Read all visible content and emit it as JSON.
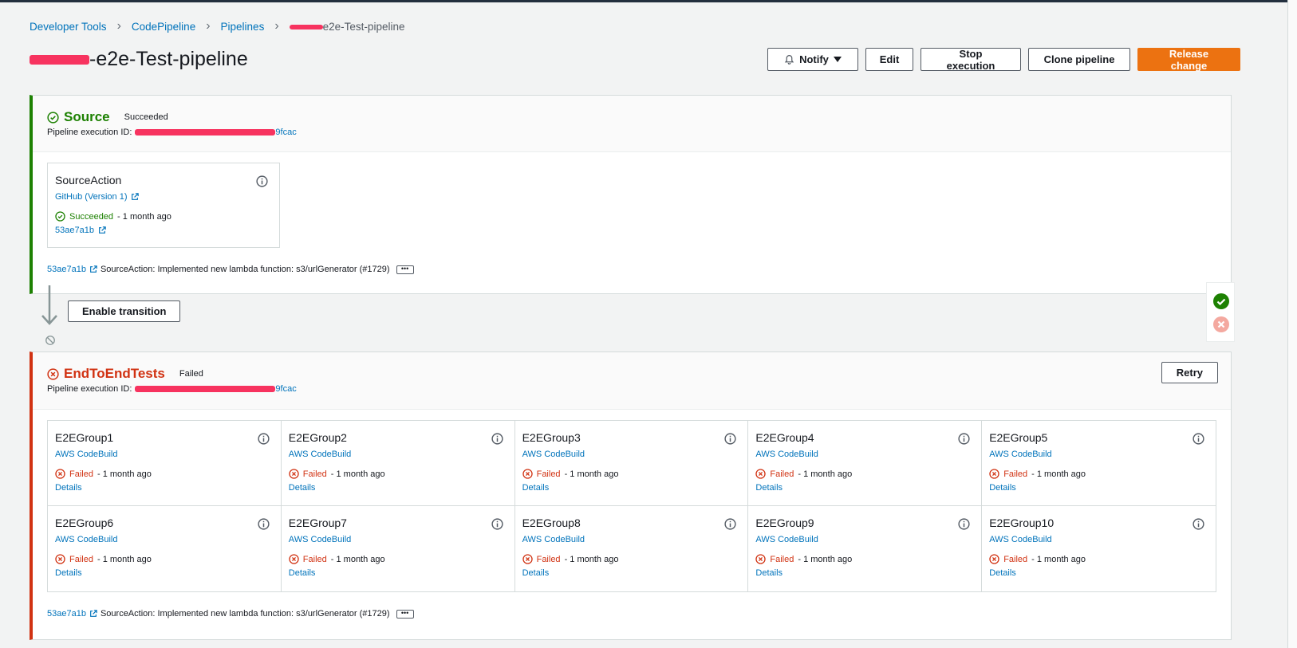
{
  "breadcrumb": {
    "items": [
      "Developer Tools",
      "CodePipeline",
      "Pipelines"
    ],
    "current": "e2e-Test-pipeline"
  },
  "page": {
    "title": "-e2e-Test-pipeline"
  },
  "header_buttons": {
    "notify": "Notify",
    "edit": "Edit",
    "stop": "Stop execution",
    "clone": "Clone pipeline",
    "release": "Release change"
  },
  "source_stage": {
    "name": "Source",
    "status": "Succeeded",
    "exec_label": "Pipeline execution ID:",
    "exec_id_suffix": "9fcac",
    "action": {
      "name": "SourceAction",
      "provider": "GitHub (Version 1)",
      "status": "Succeeded",
      "time": "- 1 month ago",
      "commit": "53ae7a1b"
    },
    "commit_line": {
      "commit": "53ae7a1b",
      "message": "SourceAction: Implemented new lambda function: s3/urlGenerator (#1729)"
    }
  },
  "transition": {
    "enable_label": "Enable transition"
  },
  "test_stage": {
    "name": "EndToEndTests",
    "status": "Failed",
    "exec_label": "Pipeline execution ID:",
    "exec_id_suffix": "9fcac",
    "retry": "Retry",
    "actions": [
      {
        "name": "E2EGroup1",
        "provider": "AWS CodeBuild",
        "status": "Failed",
        "time": "- 1 month ago",
        "link": "Details"
      },
      {
        "name": "E2EGroup2",
        "provider": "AWS CodeBuild",
        "status": "Failed",
        "time": "- 1 month ago",
        "link": "Details"
      },
      {
        "name": "E2EGroup3",
        "provider": "AWS CodeBuild",
        "status": "Failed",
        "time": "- 1 month ago",
        "link": "Details"
      },
      {
        "name": "E2EGroup4",
        "provider": "AWS CodeBuild",
        "status": "Failed",
        "time": "- 1 month ago",
        "link": "Details"
      },
      {
        "name": "E2EGroup5",
        "provider": "AWS CodeBuild",
        "status": "Failed",
        "time": "- 1 month ago",
        "link": "Details"
      },
      {
        "name": "E2EGroup6",
        "provider": "AWS CodeBuild",
        "status": "Failed",
        "time": "- 1 month ago",
        "link": "Details"
      },
      {
        "name": "E2EGroup7",
        "provider": "AWS CodeBuild",
        "status": "Failed",
        "time": "- 1 month ago",
        "link": "Details"
      },
      {
        "name": "E2EGroup8",
        "provider": "AWS CodeBuild",
        "status": "Failed",
        "time": "- 1 month ago",
        "link": "Details"
      },
      {
        "name": "E2EGroup9",
        "provider": "AWS CodeBuild",
        "status": "Failed",
        "time": "- 1 month ago",
        "link": "Details"
      },
      {
        "name": "E2EGroup10",
        "provider": "AWS CodeBuild",
        "status": "Failed",
        "time": "- 1 month ago",
        "link": "Details"
      }
    ],
    "commit_line": {
      "commit": "53ae7a1b",
      "message": "SourceAction: Implemented new lambda function: s3/urlGenerator (#1729)"
    }
  },
  "colors": {
    "success": "#1d8102",
    "failure": "#d13212",
    "link": "#0073bb",
    "primary": "#ec7211",
    "redaction": "#f7335f"
  },
  "icons": [
    "chevron-right-icon",
    "bell-icon",
    "caret-down-icon",
    "check-circle-icon",
    "x-circle-icon",
    "info-icon",
    "external-link-icon",
    "arrow-down-icon",
    "disabled-icon",
    "ellipsis-icon"
  ]
}
